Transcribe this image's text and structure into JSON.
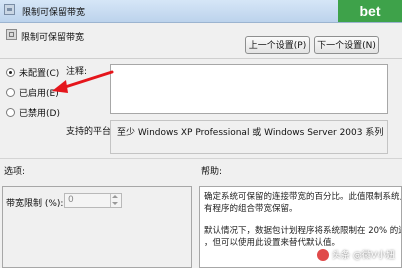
{
  "window": {
    "title": "限制可保留带宽",
    "overlay_text": "bet"
  },
  "header": {
    "title": "限制可保留带宽",
    "prev_button": "上一个设置(P)",
    "next_button": "下一个设置(N)"
  },
  "state": {
    "options": [
      {
        "label": "未配置(C)",
        "selected": true
      },
      {
        "label": "已启用(E)",
        "selected": false
      },
      {
        "label": "已禁用(D)",
        "selected": false
      }
    ]
  },
  "comment": {
    "label": "注释:",
    "value": ""
  },
  "supported": {
    "label": "支持的平台:",
    "value": "至少 Windows XP Professional 或 Windows Server 2003 系列"
  },
  "options_panel": {
    "title": "选项:",
    "bandwidth_label": "带宽限制 (%):",
    "bandwidth_value": "0"
  },
  "help_panel": {
    "title": "帮助:",
    "para1_line1": "确定系统可保留的连接带宽的百分比。此值限制系统上运行的所",
    "para1_line2": "有程序的组合带宽保留。",
    "para2_line1": "默认情况下，数据包计划程序将系统限制在 20% 的连接带宽",
    "para2_line2": "，但可以使用此设置来替代默认值。"
  },
  "watermark": {
    "text": "头条 @微V小妞"
  },
  "colors": {
    "annotation_arrow": "#e5151b",
    "overlay_green": "#3ea24a"
  }
}
